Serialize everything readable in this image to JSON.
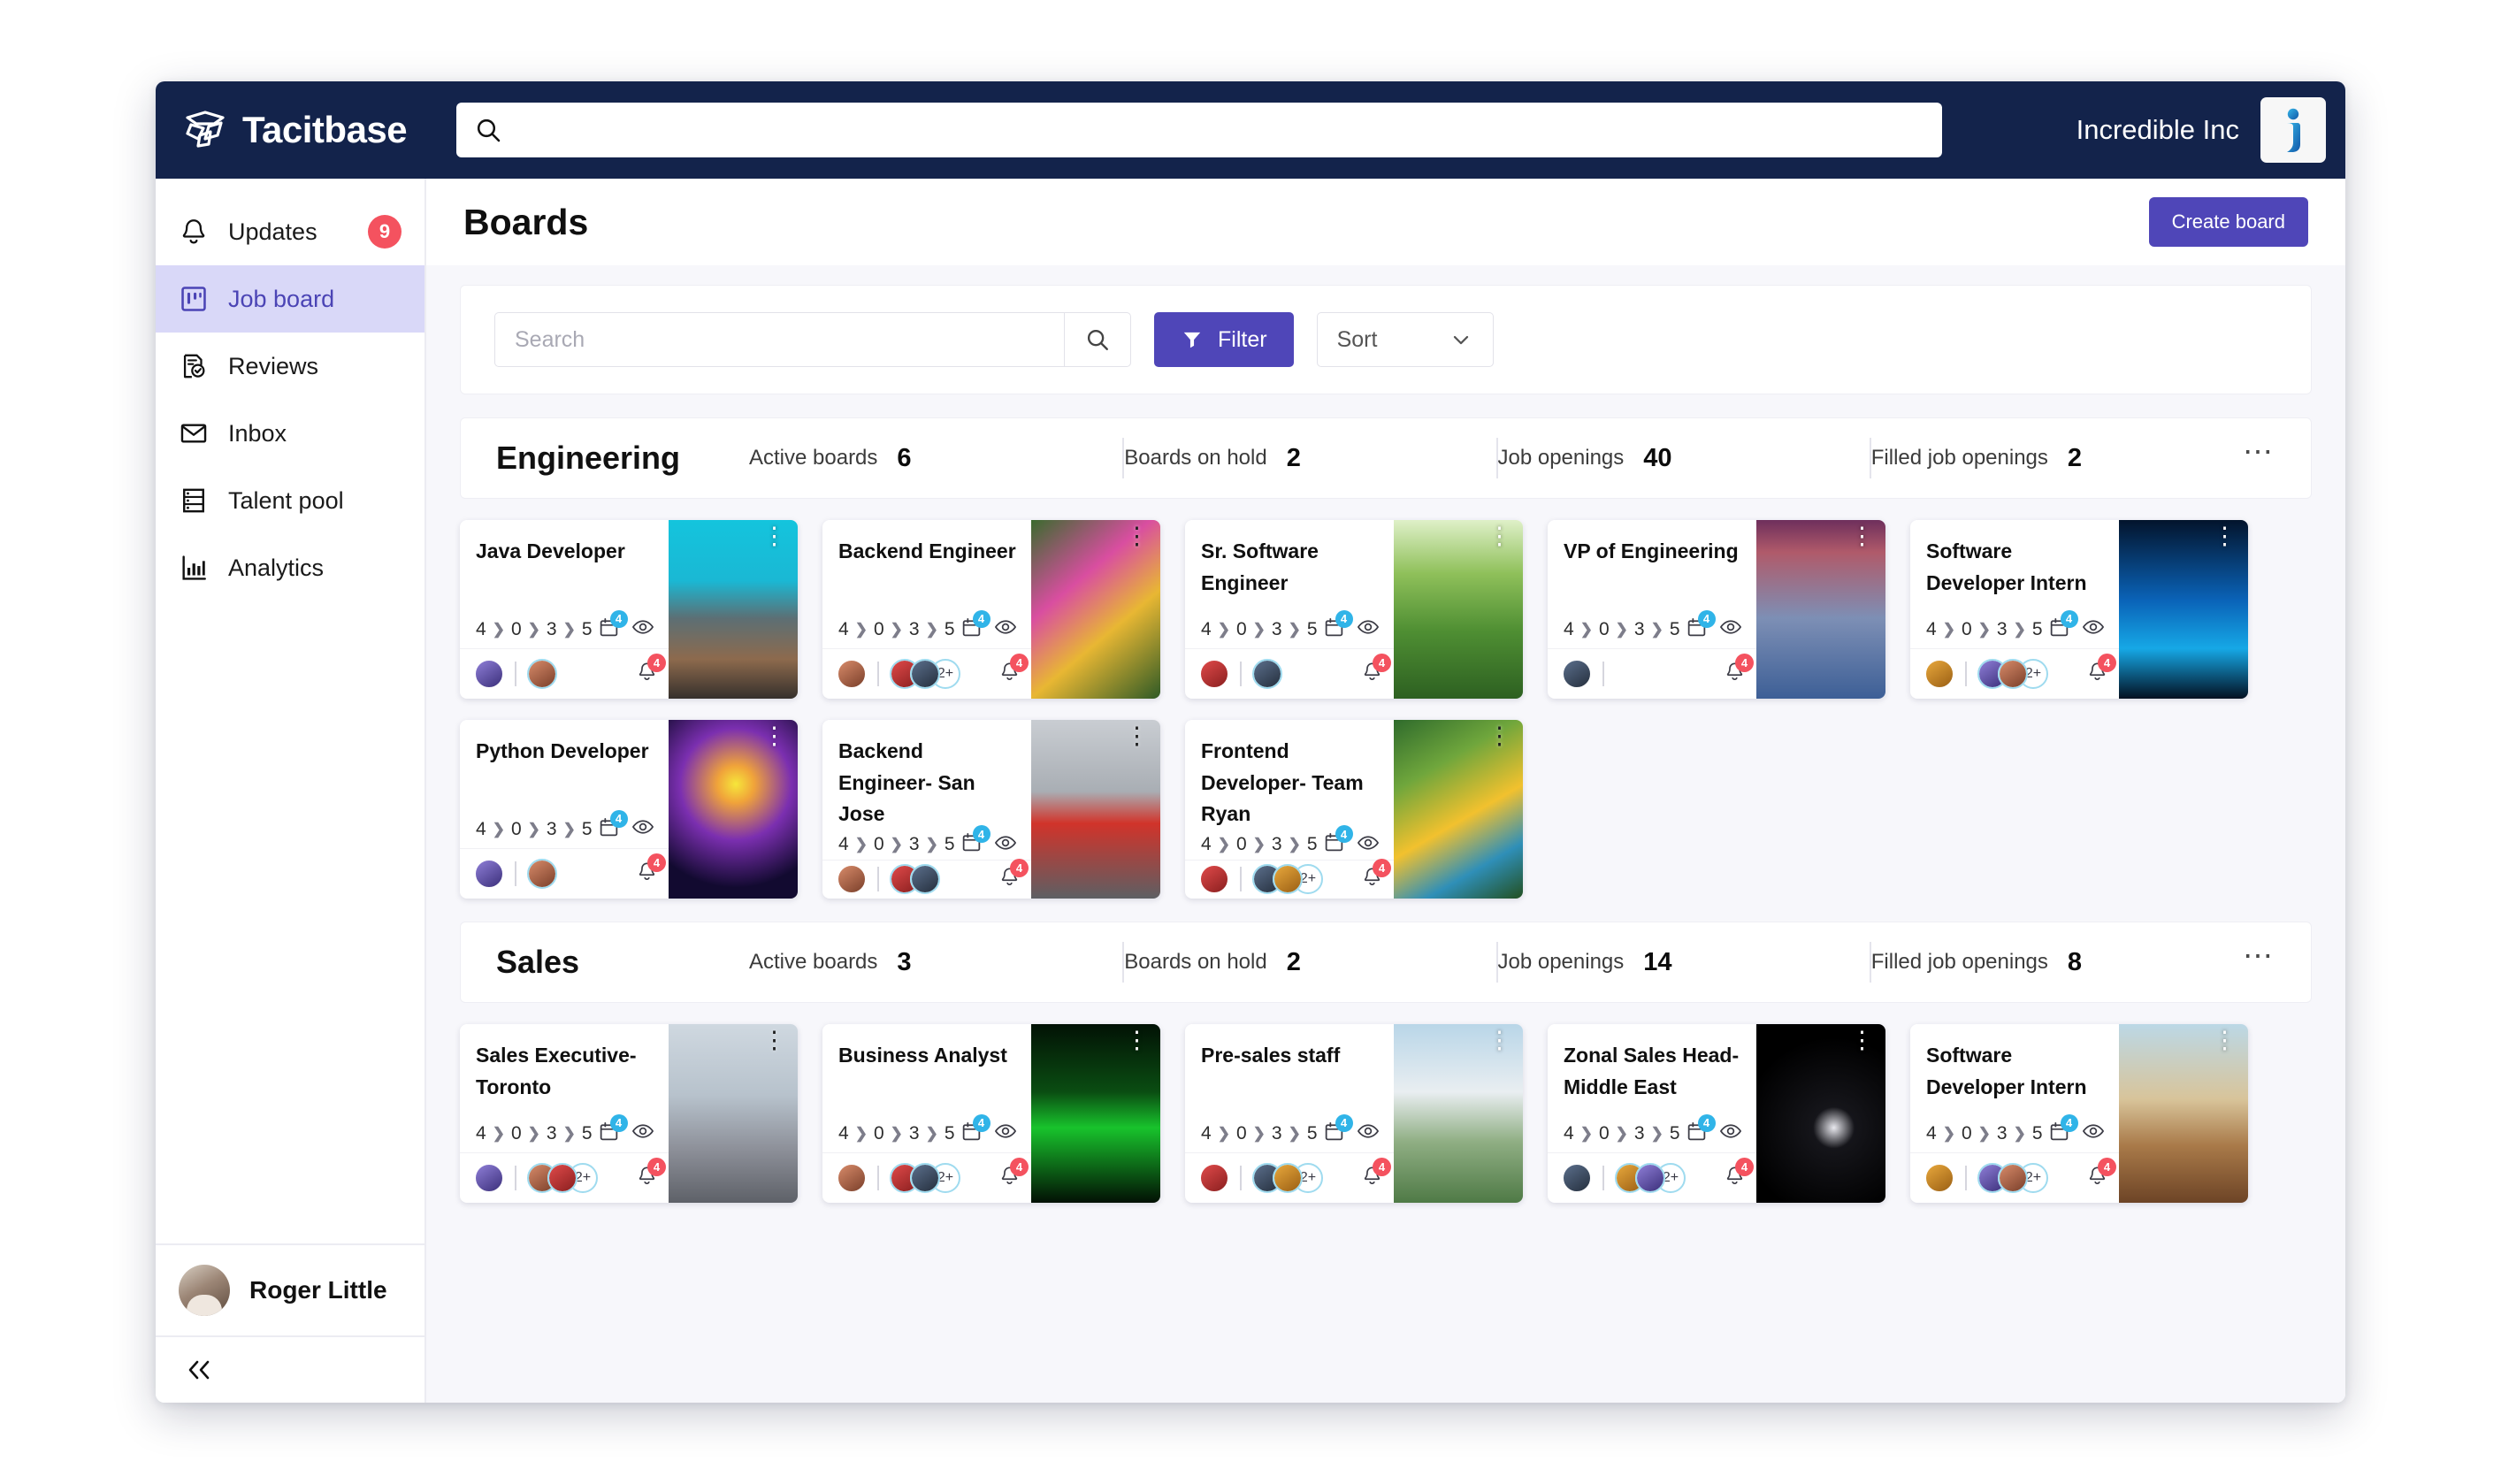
{
  "topbar": {
    "brand_name": "Tacitbase",
    "brand_logo_icon": "tacitbase-logo-icon",
    "search_icon": "search-icon",
    "search_value": "",
    "search_placeholder": "",
    "company_name": "Incredible Inc",
    "company_avatar_icon": "incredible-inc-logo-icon"
  },
  "sidebar": {
    "items": [
      {
        "label": "Updates",
        "icon": "bell-icon",
        "badge": "9",
        "active": false
      },
      {
        "label": "Job board",
        "icon": "board-icon",
        "badge": "",
        "active": true
      },
      {
        "label": "Reviews",
        "icon": "review-check-icon",
        "badge": "",
        "active": false
      },
      {
        "label": "Inbox",
        "icon": "envelope-icon",
        "badge": "",
        "active": false
      },
      {
        "label": "Talent pool",
        "icon": "talent-pool-icon",
        "badge": "",
        "active": false
      },
      {
        "label": "Analytics",
        "icon": "bar-chart-icon",
        "badge": "",
        "active": false
      }
    ],
    "user_name": "Roger Little",
    "collapse_icon": "double-chevron-left-icon"
  },
  "page": {
    "title": "Boards",
    "create_board_label": "Create board"
  },
  "toolbar": {
    "search_value": "",
    "search_placeholder": "Search",
    "search_icon": "search-icon",
    "filter_label": "Filter",
    "filter_icon": "funnel-icon",
    "sort_label": "Sort",
    "sort_icon": "chevron-down-icon"
  },
  "stat_labels": {
    "active_boards": "Active boards",
    "boards_on_hold": "Boards on hold",
    "job_openings": "Job openings",
    "filled_job_openings": "Filled job openings"
  },
  "colors": {
    "topbar_bg": "#13234b",
    "accent_purple": "#4f46b8",
    "sidebar_active_bg": "#d9d8f8",
    "sidebar_active_text": "#4b44b5",
    "badge_red": "#f4525f",
    "badge_blue": "#30b4e8",
    "page_bg": "#f7f7fb"
  },
  "card_icons": {
    "calendar_icon": "calendar-icon",
    "eye_icon": "eye-icon",
    "unlock_icon": "unlock-icon",
    "bell_icon": "bell-icon",
    "kebab_icon": "kebab-menu-icon"
  },
  "departments": [
    {
      "name": "Engineering",
      "active_boards": "6",
      "boards_on_hold": "2",
      "job_openings": "40",
      "filled_job_openings": "2",
      "menu_icon": "ellipsis-icon",
      "rows": [
        [
          {
            "title": "Java Developer",
            "pipeline": [
              "4",
              "0",
              "3",
              "5"
            ],
            "calendar_badge": "4",
            "bell_badge": "4",
            "avatars": 2,
            "overflow": "",
            "thumb": "mountain",
            "kebab_light": true
          },
          {
            "title": "Backend Engineer",
            "pipeline": [
              "4",
              "0",
              "3",
              "5"
            ],
            "calendar_badge": "4",
            "bell_badge": "4",
            "avatars": 3,
            "overflow": "2+",
            "thumb": "flower",
            "kebab_light": false
          },
          {
            "title": "Sr. Software Engineer",
            "pipeline": [
              "4",
              "0",
              "3",
              "5"
            ],
            "calendar_badge": "4",
            "bell_badge": "4",
            "avatars": 2,
            "overflow": "",
            "thumb": "hills",
            "kebab_light": true
          },
          {
            "title": "VP of Engineering",
            "pipeline": [
              "4",
              "0",
              "3",
              "5"
            ],
            "calendar_badge": "4",
            "bell_badge": "4",
            "avatars": 1,
            "overflow": "",
            "thumb": "comet",
            "kebab_light": true
          },
          {
            "title": "Software Developer Intern",
            "pipeline": [
              "4",
              "0",
              "3",
              "5"
            ],
            "calendar_badge": "4",
            "bell_badge": "4",
            "avatars": 3,
            "overflow": "2+",
            "thumb": "wave",
            "kebab_light": true
          }
        ],
        [
          {
            "title": "Python Developer",
            "pipeline": [
              "4",
              "0",
              "3",
              "5"
            ],
            "calendar_badge": "4",
            "bell_badge": "4",
            "avatars": 2,
            "overflow": "",
            "thumb": "jellyfish",
            "kebab_light": true
          },
          {
            "title": "Backend Engineer- San Jose",
            "pipeline": [
              "4",
              "0",
              "3",
              "5"
            ],
            "calendar_badge": "4",
            "bell_badge": "4",
            "avatars": 3,
            "overflow": "",
            "thumb": "car",
            "kebab_light": false
          },
          {
            "title": "Frontend Developer- Team Ryan",
            "pipeline": [
              "4",
              "0",
              "3",
              "5"
            ],
            "calendar_badge": "4",
            "bell_badge": "4",
            "avatars": 3,
            "overflow": "2+",
            "thumb": "parrot",
            "kebab_light": false
          }
        ]
      ]
    },
    {
      "name": "Sales",
      "active_boards": "3",
      "boards_on_hold": "2",
      "job_openings": "14",
      "filled_job_openings": "8",
      "menu_icon": "ellipsis-icon",
      "rows": [
        [
          {
            "title": "Sales Executive- Toronto",
            "pipeline": [
              "4",
              "0",
              "3",
              "5"
            ],
            "calendar_badge": "4",
            "bell_badge": "4",
            "avatars": 3,
            "overflow": "2+",
            "thumb": "cathedral",
            "kebab_light": false
          },
          {
            "title": "Business Analyst",
            "pipeline": [
              "4",
              "0",
              "3",
              "5"
            ],
            "calendar_badge": "4",
            "bell_badge": "4",
            "avatars": 3,
            "overflow": "2+",
            "thumb": "matrix",
            "kebab_light": true
          },
          {
            "title": "Pre-sales staff",
            "pipeline": [
              "4",
              "0",
              "3",
              "5"
            ],
            "calendar_badge": "4",
            "bell_badge": "4",
            "avatars": 3,
            "overflow": "2+",
            "thumb": "cloud",
            "kebab_light": true
          },
          {
            "title": "Zonal Sales Head- Middle East",
            "pipeline": [
              "4",
              "0",
              "3",
              "5"
            ],
            "calendar_badge": "4",
            "bell_badge": "4",
            "avatars": 3,
            "overflow": "2+",
            "thumb": "astronaut",
            "kebab_light": true
          },
          {
            "title": "Software Developer Intern",
            "pipeline": [
              "4",
              "0",
              "3",
              "5"
            ],
            "calendar_badge": "4",
            "bell_badge": "4",
            "avatars": 3,
            "overflow": "2+",
            "thumb": "canyon",
            "kebab_light": true
          }
        ]
      ]
    }
  ]
}
